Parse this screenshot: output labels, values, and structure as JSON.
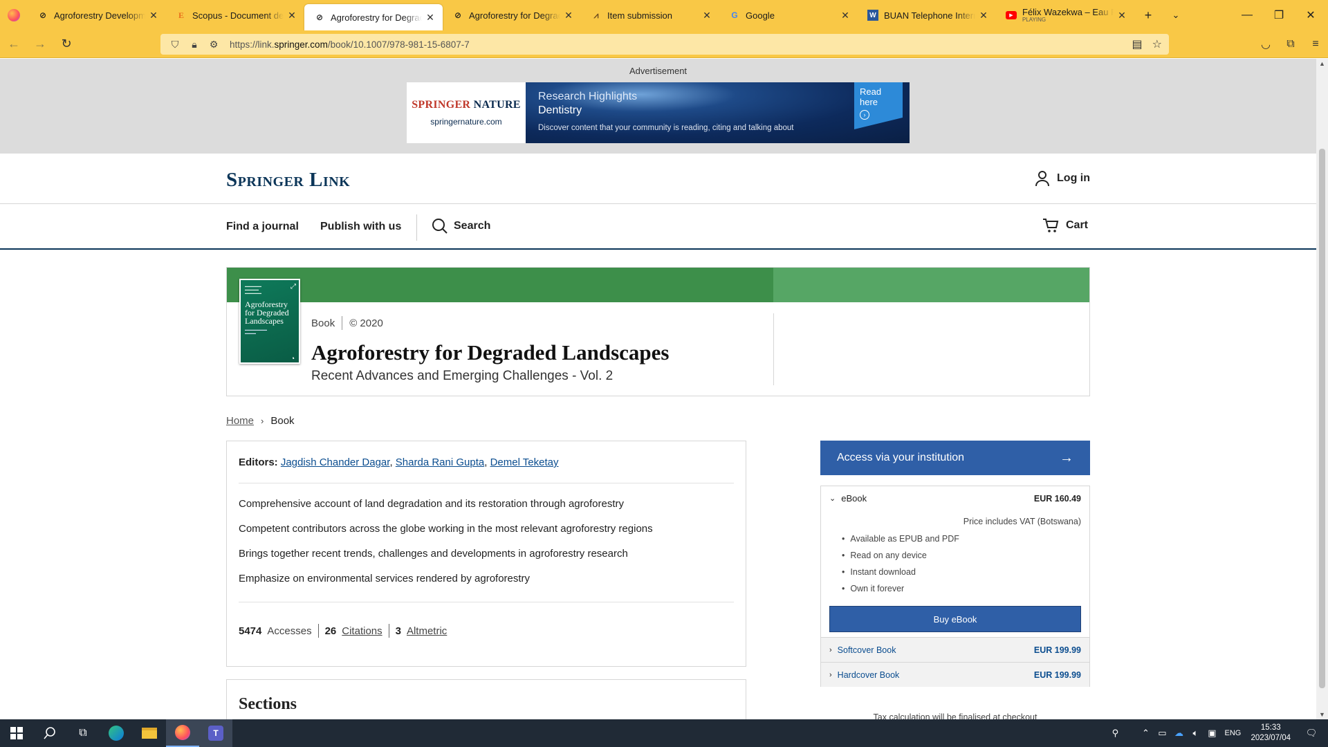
{
  "browser": {
    "tabs": [
      {
        "label": "Agroforestry Development",
        "favicon": "springer-favicon",
        "active": false
      },
      {
        "label": "Scopus - Document details",
        "favicon": "scopus-favicon",
        "active": false
      },
      {
        "label": "Agroforestry for Degraded L",
        "favicon": "springer-favicon",
        "active": true
      },
      {
        "label": "Agroforestry for Degraded L",
        "favicon": "springer-favicon",
        "active": false
      },
      {
        "label": "Item submission",
        "favicon": "dspace-favicon",
        "active": false
      },
      {
        "label": "Google",
        "favicon": "google-favicon",
        "active": false
      },
      {
        "label": "BUAN Telephone Internal D",
        "favicon": "word-favicon",
        "active": false
      },
      {
        "label": "Félix Wazekwa – Eau Pure fe",
        "sublabel": "PLAYING",
        "favicon": "youtube-favicon",
        "active": false
      }
    ],
    "url_prefix": "https://link.",
    "url_domain": "springer.com",
    "url_path": "/book/10.1007/978-981-15-6807-7"
  },
  "ad": {
    "label": "Advertisement",
    "brand_red": "SPRINGER",
    "brand_blue": " NATURE",
    "site": "springernature.com",
    "headline": "Research Highlights",
    "topic": "Dentistry",
    "tagline": "Discover content that your community is reading, citing and talking about",
    "cta": "Read here"
  },
  "header": {
    "logo": "Springer Link",
    "login": "Log in"
  },
  "nav": {
    "find_journal": "Find a journal",
    "publish": "Publish with us",
    "search": "Search",
    "cart": "Cart"
  },
  "book": {
    "type": "Book",
    "year": "© 2020",
    "title": "Agroforestry for Degraded Landscapes",
    "subtitle": "Recent Advances and Emerging Challenges - Vol. 2",
    "cover_title": "Agroforestry for Degraded Landscapes"
  },
  "breadcrumb": {
    "home": "Home",
    "current": "Book"
  },
  "details": {
    "editors_label": "Editors:",
    "editors": [
      "Jagdish Chander Dagar",
      "Sharda Rani Gupta",
      "Demel Teketay"
    ],
    "highlights": [
      "Comprehensive account of land degradation and its restoration through agroforestry",
      "Competent contributors across the globe working in the most relevant agroforestry regions",
      "Brings together recent trends, challenges and developments in agroforestry research",
      "Emphasize on environmental services rendered by agroforestry"
    ],
    "accesses_count": "5474",
    "accesses_label": "Accesses",
    "citations_count": "26",
    "citations_label": "Citations",
    "altmetric_count": "3",
    "altmetric_label": "Altmetric"
  },
  "sections": {
    "title": "Sections"
  },
  "purchase": {
    "access_label": "Access via your institution",
    "ebook_label": "eBook",
    "ebook_price": "EUR 160.49",
    "vat_note": "Price includes VAT (Botswana)",
    "features": [
      "Available as EPUB and PDF",
      "Read on any device",
      "Instant download",
      "Own it forever"
    ],
    "buy_label": "Buy eBook",
    "softcover_label": "Softcover Book",
    "softcover_price": "EUR 199.99",
    "hardcover_label": "Hardcover Book",
    "hardcover_price": "EUR 199.99",
    "tax_note": "Tax calculation will be finalised at checkout"
  },
  "taskbar": {
    "language": "ENG",
    "time": "15:33",
    "date": "2023/07/04"
  },
  "colors": {
    "springer_navy": "#0b3558",
    "hero_green": "#3d8f4a",
    "hero_green_light": "#56a665",
    "button_blue": "#2f5fa7",
    "firefox_toolbar": "#f9c846"
  }
}
